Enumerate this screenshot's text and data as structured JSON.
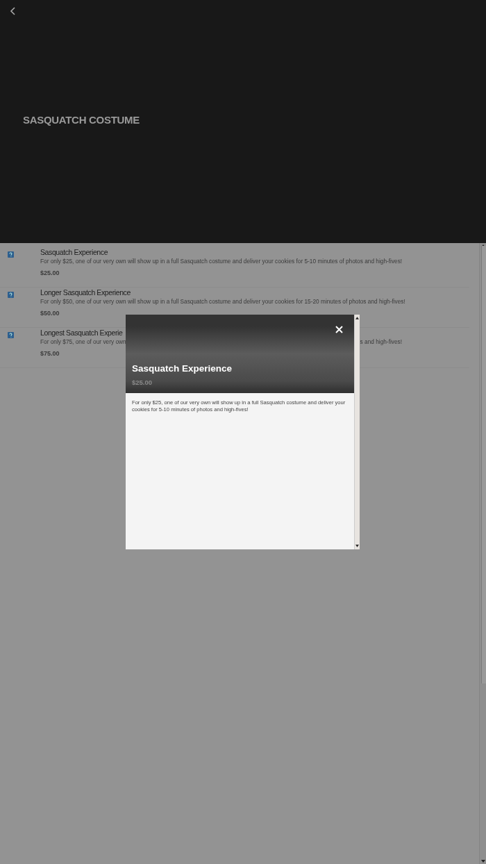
{
  "header": {
    "title": "SASQUATCH COSTUME"
  },
  "items": [
    {
      "name": "Sasquatch Experience",
      "description": "For only $25, one of our very own will show up in a full Sasquatch costume and deliver your cookies for 5-10 minutes of photos and high-fives!",
      "price": "$25.00"
    },
    {
      "name": "Longer Sasquatch Experience",
      "description": "For only $50, one of our very own will show up in a full Sasquatch costume and deliver your cookies for 15-20 minutes of photos and high-fives!",
      "price": "$50.00"
    },
    {
      "name": "Longest Sasquatch Experie",
      "description": "For only $75, one of our very own",
      "description_tail": "s and high-fives!",
      "price": "$75.00"
    }
  ],
  "modal": {
    "title": "Sasquatch Experience",
    "price": "$25.00",
    "description": "For only $25, one of our very own will show up in a full Sasquatch costume and deliver your cookies for 5-10 minutes of photos and high-fives!"
  }
}
